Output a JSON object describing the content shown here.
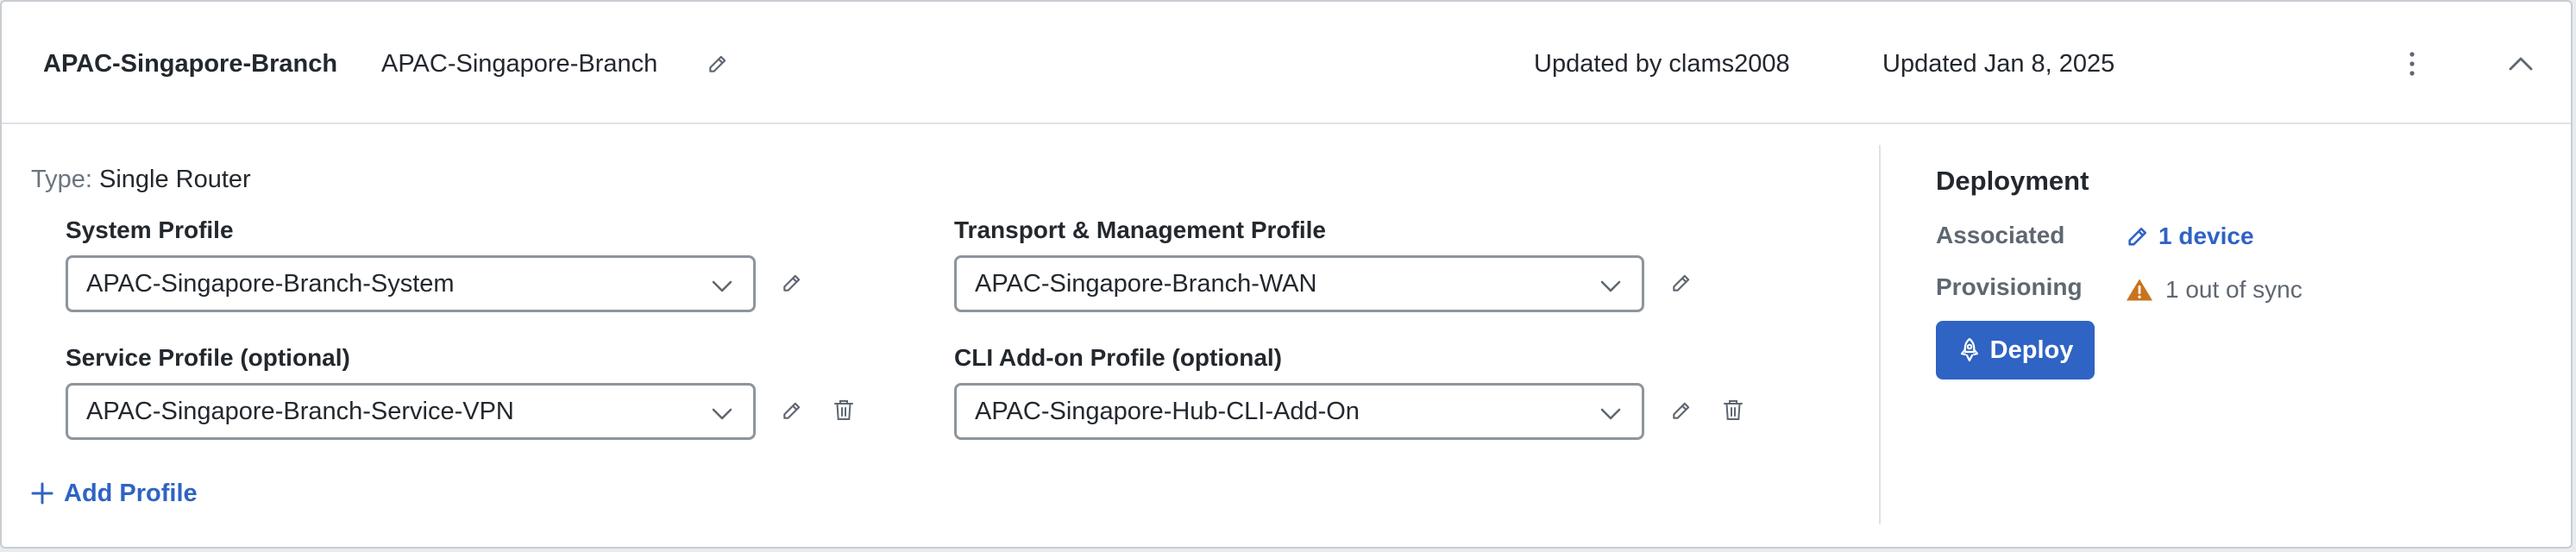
{
  "header": {
    "title": "APAC-Singapore-Branch",
    "name": "APAC-Singapore-Branch",
    "updated_by": "Updated by clams2008",
    "updated_date": "Updated Jan 8, 2025"
  },
  "type": {
    "label": "Type:",
    "value": "Single Router"
  },
  "profiles": {
    "system": {
      "label": "System Profile",
      "value": "APAC-Singapore-Branch-System"
    },
    "transport": {
      "label": "Transport & Management Profile",
      "value": "APAC-Singapore-Branch-WAN"
    },
    "service": {
      "label": "Service Profile (optional)",
      "value": "APAC-Singapore-Branch-Service-VPN"
    },
    "cli": {
      "label": "CLI Add-on Profile (optional)",
      "value": "APAC-Singapore-Hub-CLI-Add-On"
    }
  },
  "add_profile_label": "Add Profile",
  "deployment": {
    "title": "Deployment",
    "associated_label": "Associated",
    "associated_value": "1 device",
    "provisioning_label": "Provisioning",
    "provisioning_value": "1 out of sync",
    "deploy_label": "Deploy"
  },
  "icons": [
    "pencil-icon",
    "kebab-menu-icon",
    "chevron-up-icon",
    "chevron-down-icon",
    "trash-icon",
    "plus-icon",
    "warning-icon",
    "rocket-icon"
  ],
  "colors": {
    "accent": "#2f63c4",
    "warning": "#c8741e",
    "border": "#8e959c"
  }
}
